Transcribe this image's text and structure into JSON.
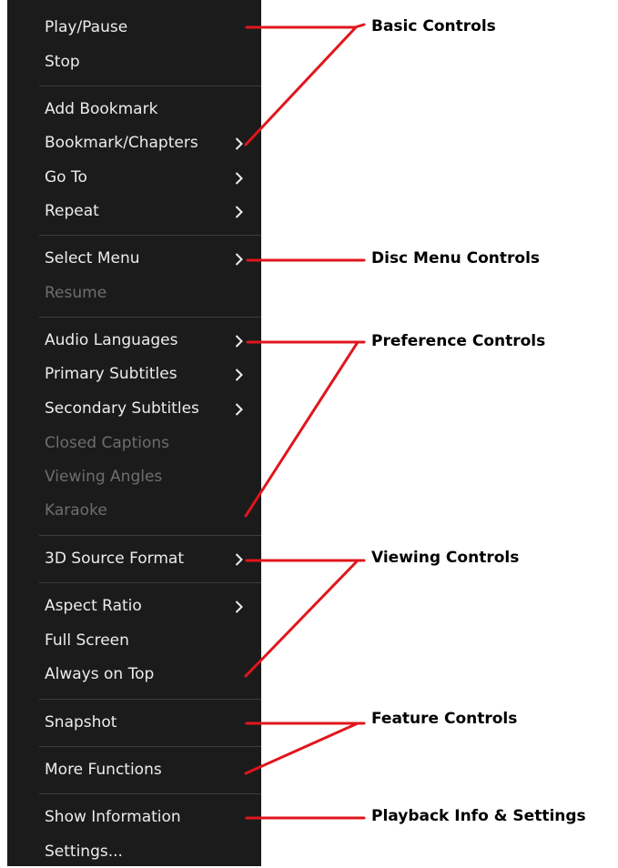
{
  "menu": {
    "items": [
      {
        "label": "Play/Pause",
        "submenu": false,
        "disabled": false
      },
      {
        "label": "Stop",
        "submenu": false,
        "disabled": false
      },
      {
        "label": "Add Bookmark",
        "submenu": false,
        "disabled": false
      },
      {
        "label": "Bookmark/Chapters",
        "submenu": true,
        "disabled": false
      },
      {
        "label": "Go To",
        "submenu": true,
        "disabled": false
      },
      {
        "label": "Repeat",
        "submenu": true,
        "disabled": false
      },
      {
        "label": "Select Menu",
        "submenu": true,
        "disabled": false
      },
      {
        "label": "Resume",
        "submenu": false,
        "disabled": true
      },
      {
        "label": "Audio Languages",
        "submenu": true,
        "disabled": false
      },
      {
        "label": "Primary Subtitles",
        "submenu": true,
        "disabled": false
      },
      {
        "label": "Secondary Subtitles",
        "submenu": true,
        "disabled": false
      },
      {
        "label": "Closed Captions",
        "submenu": false,
        "disabled": true
      },
      {
        "label": "Viewing Angles",
        "submenu": false,
        "disabled": true
      },
      {
        "label": "Karaoke",
        "submenu": false,
        "disabled": true
      },
      {
        "label": "3D Source Format",
        "submenu": true,
        "disabled": false
      },
      {
        "label": "Aspect Ratio",
        "submenu": true,
        "disabled": false
      },
      {
        "label": "Full Screen",
        "submenu": false,
        "disabled": false
      },
      {
        "label": "Always on Top",
        "submenu": false,
        "disabled": false
      },
      {
        "label": "Snapshot",
        "submenu": false,
        "disabled": false
      },
      {
        "label": "More Functions",
        "submenu": false,
        "disabled": false
      },
      {
        "label": "Show Information",
        "submenu": false,
        "disabled": false
      },
      {
        "label": "Settings...",
        "submenu": false,
        "disabled": false
      }
    ]
  },
  "callouts": [
    {
      "label": "Basic Controls"
    },
    {
      "label": "Disc Menu Controls"
    },
    {
      "label": "Preference Controls"
    },
    {
      "label": "Viewing Controls"
    },
    {
      "label": "Feature Controls"
    },
    {
      "label": "Playback  Info & Settings"
    }
  ],
  "colors": {
    "menu_background": "#1b1b1b",
    "menu_text": "#ececec",
    "menu_text_disabled": "#6e6e6e",
    "separator": "#3d3d3d",
    "callout_line": "#e0161c"
  }
}
